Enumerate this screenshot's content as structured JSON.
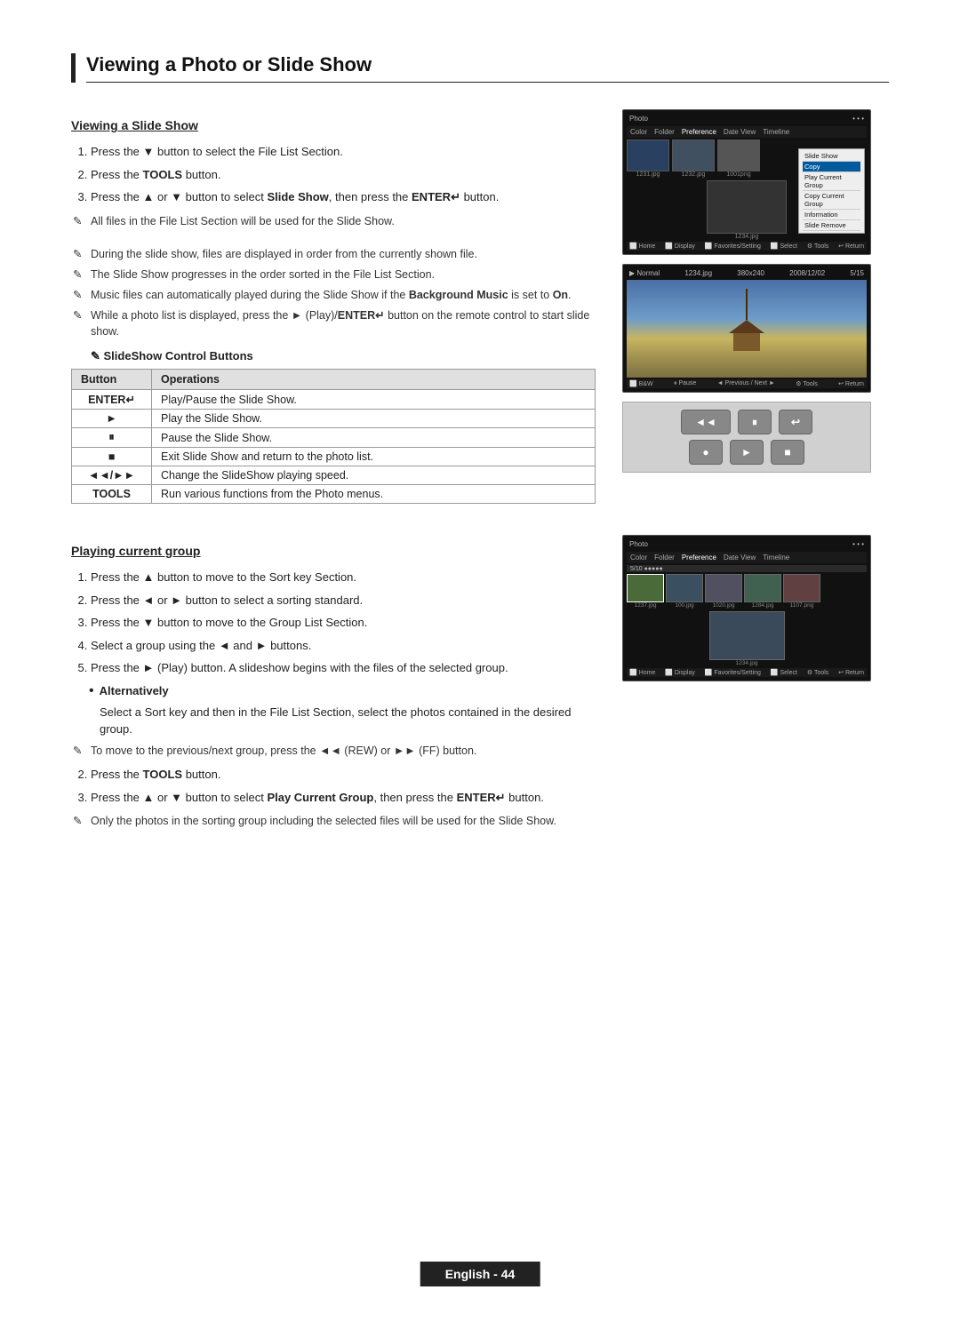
{
  "page": {
    "title": "Viewing a Photo or Slide Show",
    "section1": {
      "header": "Viewing a Slide Show",
      "steps": [
        "Press the ▼ button to select the File List Section.",
        "Press the TOOLS button.",
        "Press the ▲ or ▼ button to select Slide Show, then press the ENTER↵ button."
      ],
      "note1": "All files in the File List Section will be used for the Slide Show.",
      "notes": [
        "During the slide show, files are displayed in order from the currently shown file.",
        "The Slide Show progresses in the order sorted in the File List Section.",
        "Music files can automatically played during the Slide Show if the Background Music is set to On.",
        "While a photo list is displayed, press the ► (Play)/ENTER↵ button on the remote control to start slide show."
      ],
      "slideshow_label": "SlideShow Control Buttons",
      "table": {
        "headers": [
          "Button",
          "Operations"
        ],
        "rows": [
          [
            "ENTER↵",
            "Play/Pause the Slide Show."
          ],
          [
            "►",
            "Play the Slide Show."
          ],
          [
            "⏸",
            "Pause the Slide Show."
          ],
          [
            "■",
            "Exit Slide Show and return to the photo list."
          ],
          [
            "◄◄/►►",
            "Change the SlideShow playing speed."
          ],
          [
            "TOOLS",
            "Run various functions from the Photo menus."
          ]
        ]
      }
    },
    "section2": {
      "header": "Playing current group",
      "steps": [
        "Press the ▲ button to move to the Sort key Section.",
        "Press the ◄ or ► button to select a sorting standard.",
        "Press the ▼ button to move to the Group List Section.",
        "Select a group using the ◄ and ► buttons.",
        "Press the ► (Play) button. A slideshow begins with the files of the selected group."
      ],
      "alternatively_label": "Alternatively",
      "alt_text": "Select a Sort key and then in the File List Section, select the photos contained in the desired group.",
      "note_alt": "To move to the previous/next group, press the ◄◄ (REW) or ►► (FF) button.",
      "step2_label": "Press the TOOLS button.",
      "step3_label": "Press the ▲ or ▼ button to select Play Current Group, then press the ENTER↵ button.",
      "note_final": "Only the photos in the sorting group including the selected files will be used for the Slide Show."
    },
    "footer": {
      "text": "English - 44"
    }
  }
}
